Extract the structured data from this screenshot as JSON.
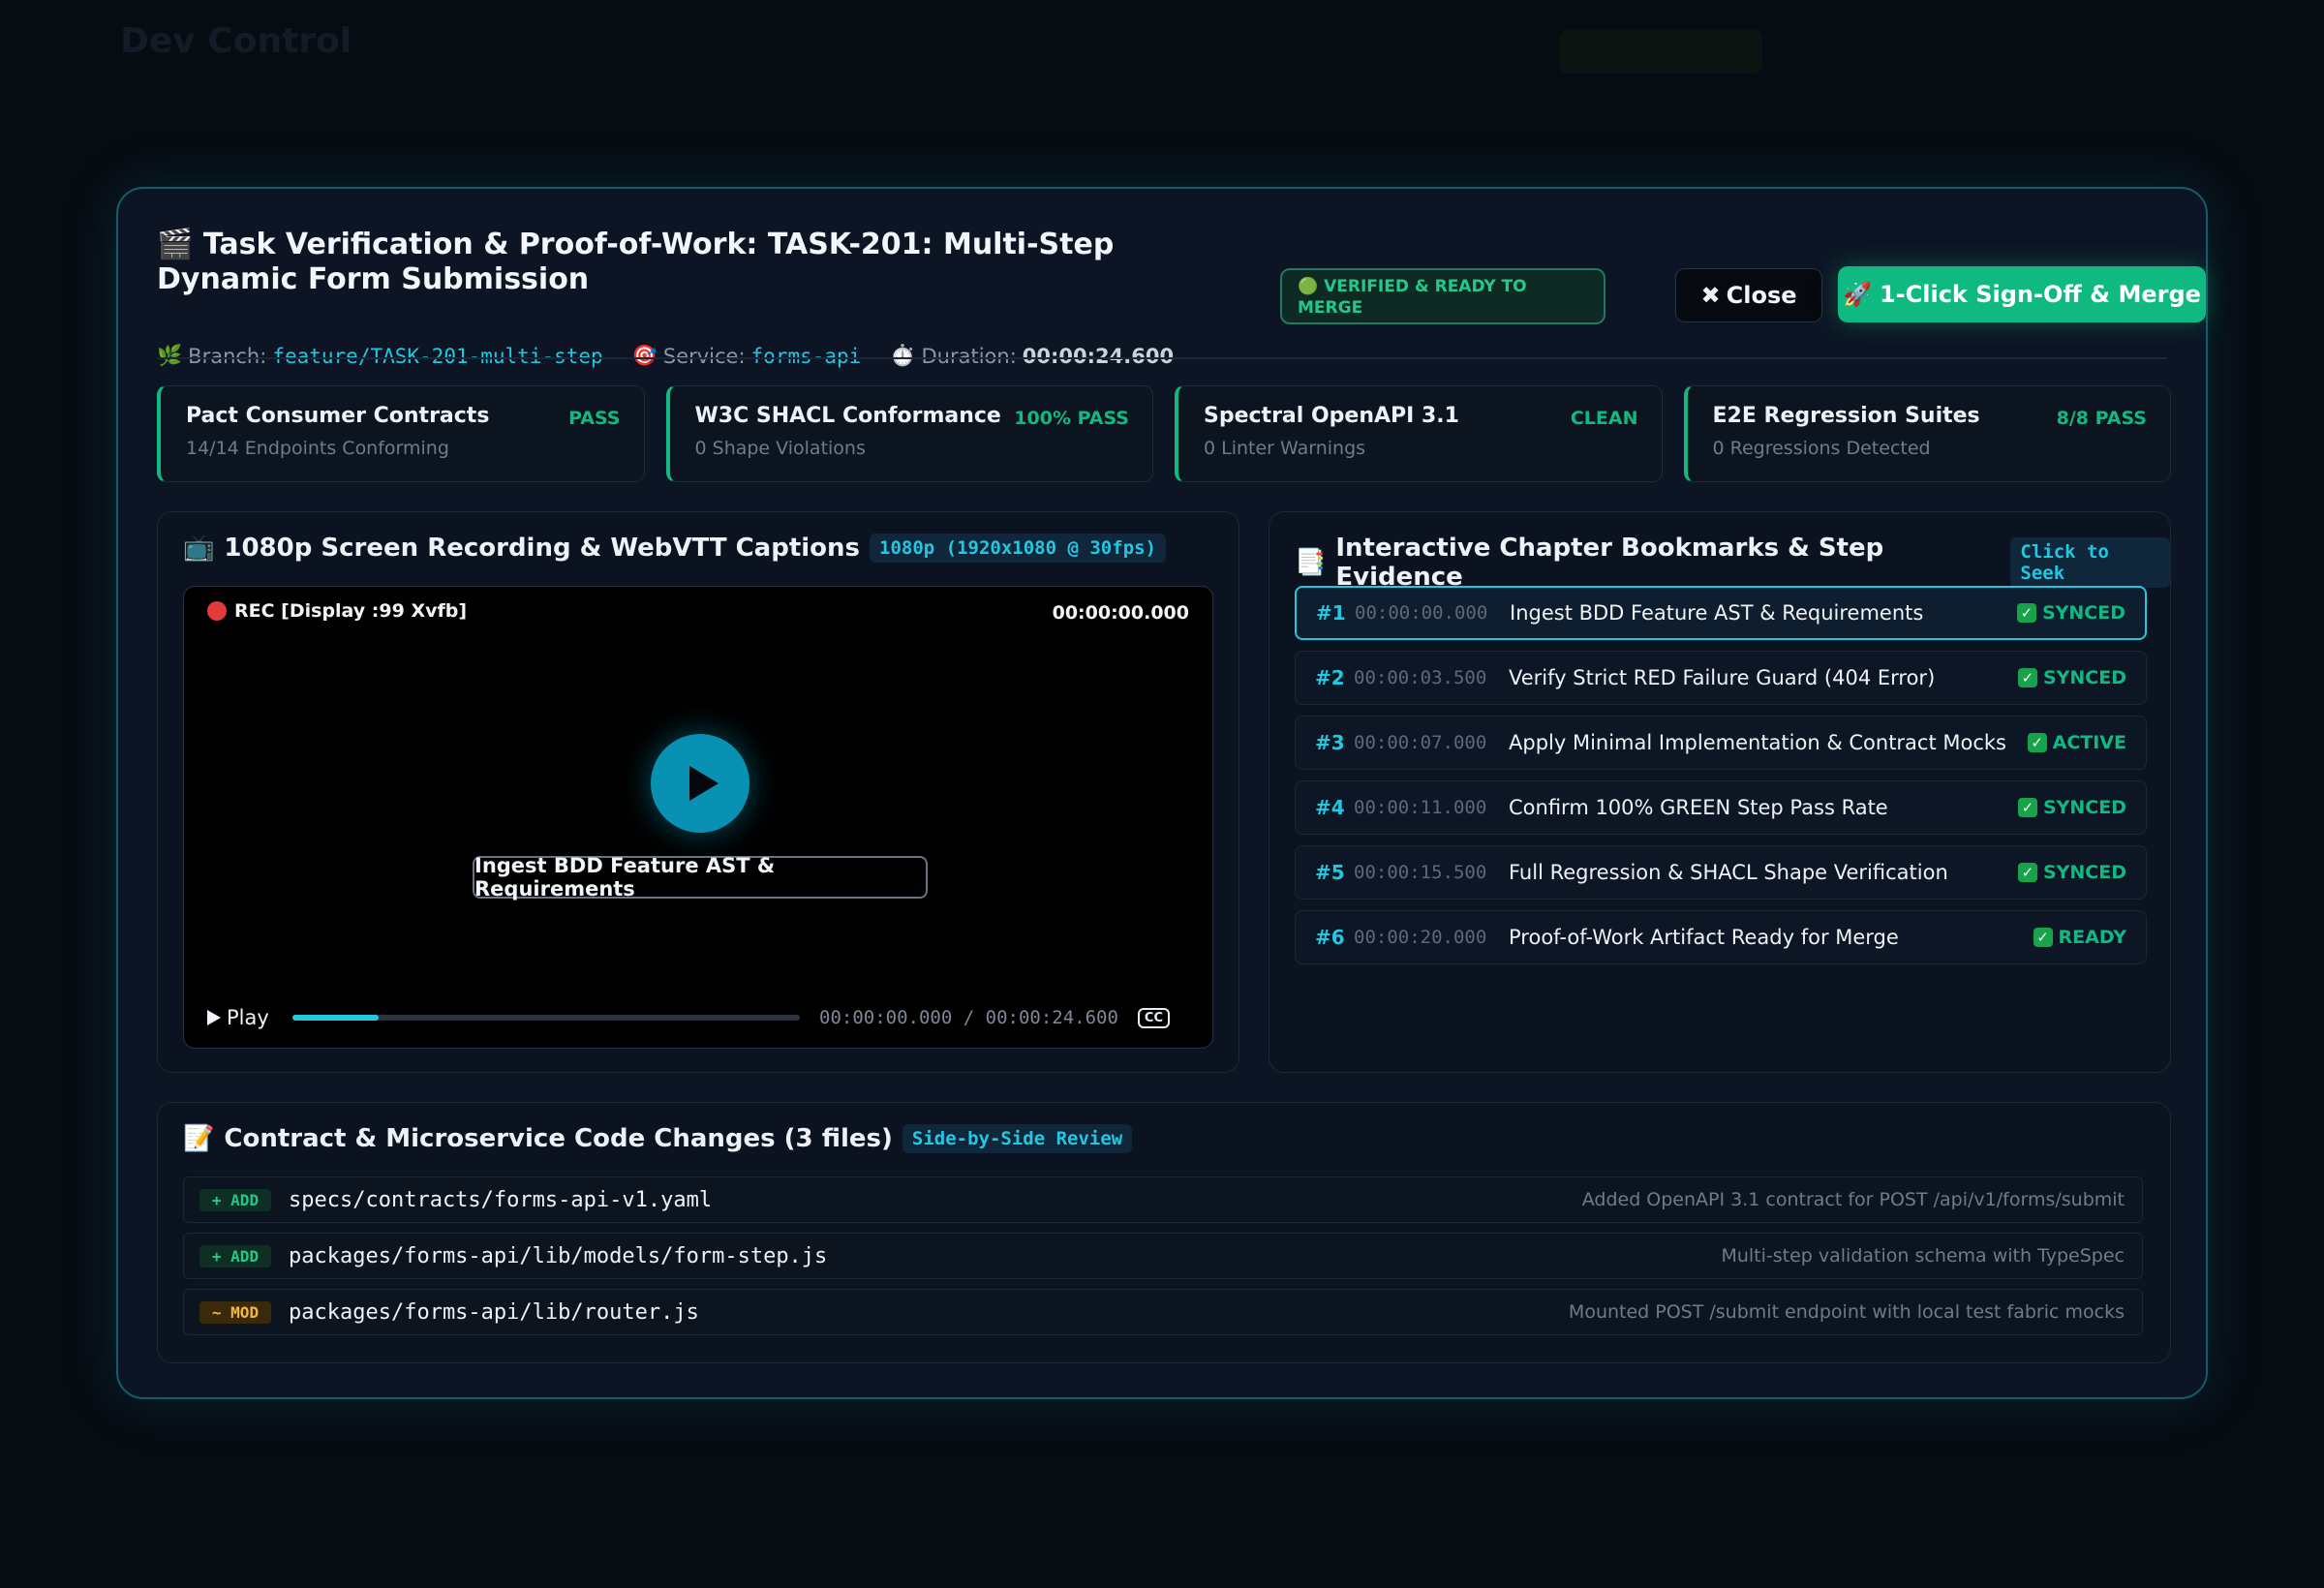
{
  "background": {
    "brand": "Dev Control"
  },
  "header": {
    "title_icon": "🎬",
    "title": "Task Verification & Proof-of-Work: TASK-201: Multi-Step Dynamic Form Submission",
    "branch_label": "Branch:",
    "branch_value": "feature/TASK-201-multi-step",
    "service_label": "Service:",
    "service_value": "forms-api",
    "duration_label": "Duration:",
    "duration_value": "00:00:24.600",
    "status_badge": "VERIFIED & READY TO MERGE",
    "close_label": "Close",
    "merge_label": "1-Click Sign-Off & Merge"
  },
  "checks": [
    {
      "name": "Pact Consumer Contracts",
      "status": "PASS",
      "sub": "14/14 Endpoints Conforming"
    },
    {
      "name": "W3C SHACL Conformance",
      "status": "100% PASS",
      "sub": "0 Shape Violations"
    },
    {
      "name": "Spectral OpenAPI 3.1",
      "status": "CLEAN",
      "sub": "0 Linter Warnings"
    },
    {
      "name": "E2E Regression Suites",
      "status": "8/8 PASS",
      "sub": "0 Regressions Detected"
    }
  ],
  "recording": {
    "title": "1080p Screen Recording & WebVTT Captions",
    "pill": "1080p (1920x1080 @ 30fps)",
    "rec_label": "REC [Display :99 Xvfb]",
    "timecode": "00:00:00.000",
    "caption": "Ingest BDD Feature AST & Requirements",
    "play_label": "Play",
    "time_current": "00:00:00.000",
    "time_separator": "/",
    "time_total": "00:00:24.600",
    "cc_label": "CC",
    "progress_fraction": 0.17
  },
  "chapters": {
    "title": "Interactive Chapter Bookmarks & Step Evidence",
    "pill": "Click to Seek",
    "items": [
      {
        "num": "#1",
        "time": "00:00:00.000",
        "label": "Ingest BDD Feature AST & Requirements",
        "status": "SYNCED"
      },
      {
        "num": "#2",
        "time": "00:00:03.500",
        "label": "Verify Strict RED Failure Guard (404 Error)",
        "status": "SYNCED"
      },
      {
        "num": "#3",
        "time": "00:00:07.000",
        "label": "Apply Minimal Implementation & Contract Mocks",
        "status": "ACTIVE"
      },
      {
        "num": "#4",
        "time": "00:00:11.000",
        "label": "Confirm 100% GREEN Step Pass Rate",
        "status": "SYNCED"
      },
      {
        "num": "#5",
        "time": "00:00:15.500",
        "label": "Full Regression & SHACL Shape Verification",
        "status": "SYNCED"
      },
      {
        "num": "#6",
        "time": "00:00:20.000",
        "label": "Proof-of-Work Artifact Ready for Merge",
        "status": "READY"
      }
    ]
  },
  "code_changes": {
    "title": "Contract & Microservice Code Changes (3 files)",
    "pill": "Side-by-Side Review",
    "files": [
      {
        "tag": "+ ADD",
        "path": "specs/contracts/forms-api-v1.yaml",
        "desc": "Added OpenAPI 3.1 contract for POST /api/v1/forms/submit"
      },
      {
        "tag": "+ ADD",
        "path": "packages/forms-api/lib/models/form-step.js",
        "desc": "Multi-step validation schema with TypeSpec"
      },
      {
        "tag": "~ MOD",
        "path": "packages/forms-api/lib/router.js",
        "desc": "Mounted POST /submit endpoint with local test fabric mocks"
      }
    ]
  },
  "colors": {
    "accent": "#22c7e0",
    "success": "#10b981",
    "modify": "#f5b83d"
  }
}
